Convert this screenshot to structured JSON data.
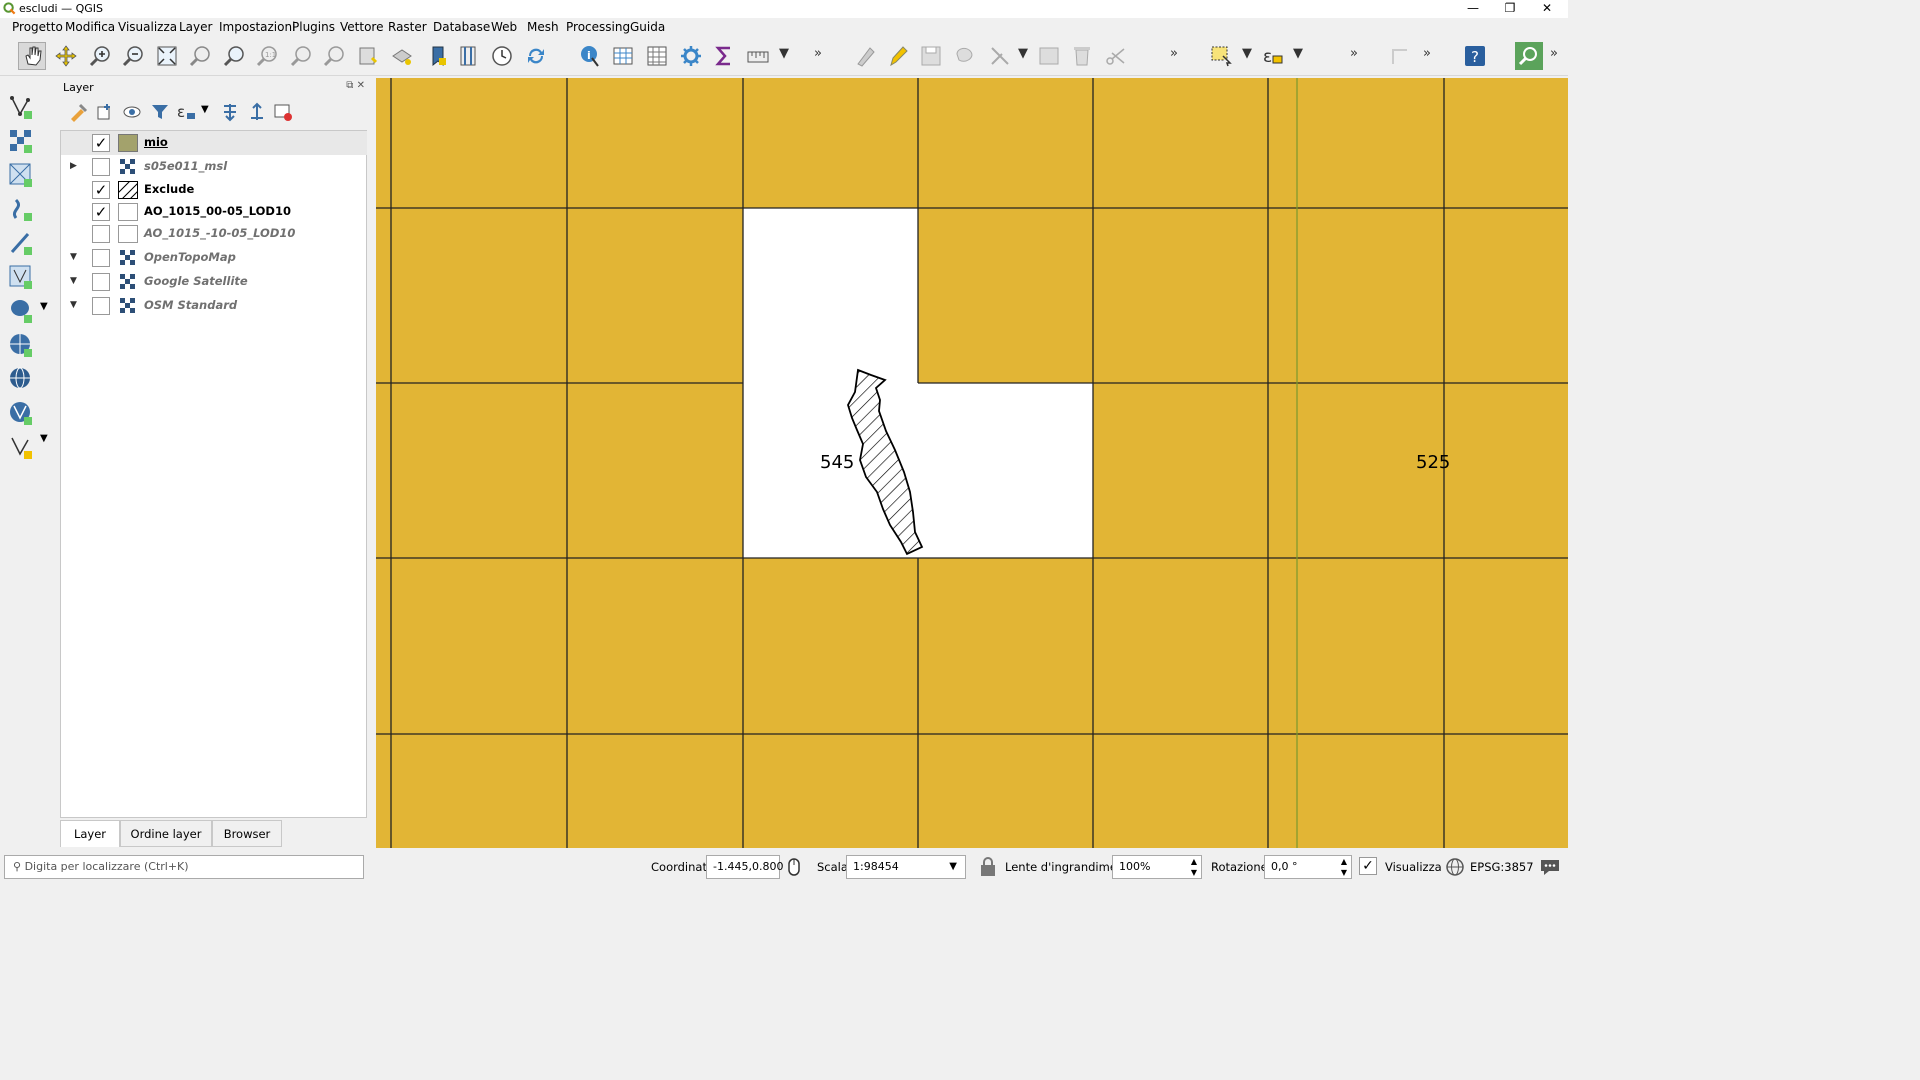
{
  "window": {
    "title": "escludi — QGIS",
    "controls": [
      "—",
      "❐",
      "✕"
    ]
  },
  "menubar": [
    "Progetto",
    "Modifica",
    "Visualizza",
    "Layer",
    "Impostazioni",
    "Plugins",
    "Vettore",
    "Raster",
    "Database",
    "Web",
    "Mesh",
    "Processing",
    "Guida"
  ],
  "toolbar": {
    "icons": [
      "pan-icon",
      "pan-to-selection-icon",
      "zoom-in-icon",
      "zoom-out-icon",
      "zoom-full-icon",
      "zoom-to-selection-icon",
      "zoom-to-layer-icon",
      "zoom-native-icon",
      "zoom-last-icon",
      "zoom-next-icon",
      "new-bookmark-icon",
      "show-bookmarks-icon",
      "new-map-view-icon",
      "new-3d-view-icon",
      "temporal-icon",
      "refresh-icon",
      "identify-icon",
      "attribute-table-icon",
      "field-calculator-icon",
      "processing-toolbox-icon",
      "statistics-icon",
      "measure-icon",
      "digitize-icon",
      "edit-pencil-icon",
      "save-edits-icon",
      "add-feature-icon",
      "vertex-tool-icon",
      "modify-attributes-icon",
      "delete-icon",
      "cut-icon",
      "select-icon",
      "select-expression-icon",
      "annotation-icon",
      "help-icon",
      "locator-icon"
    ],
    "more": "»"
  },
  "layers_panel": {
    "title": "Layer",
    "layers": [
      {
        "name": "mio",
        "checked": true,
        "expand": "",
        "style": "bu",
        "symbol": "fill-olive"
      },
      {
        "name": "s05e011_msl",
        "checked": false,
        "expand": "▶",
        "style": "i",
        "symbol": "raster"
      },
      {
        "name": "Exclude",
        "checked": true,
        "expand": "",
        "style": "b",
        "symbol": "hatch"
      },
      {
        "name": "AO_1015_00-05_LOD10",
        "checked": true,
        "expand": "",
        "style": "b",
        "symbol": "outline"
      },
      {
        "name": "AO_1015_-10-05_LOD10",
        "checked": false,
        "expand": "",
        "style": "i",
        "symbol": "outline"
      },
      {
        "name": "OpenTopoMap",
        "checked": false,
        "expand": "▼",
        "style": "i",
        "symbol": "raster"
      },
      {
        "name": "Google Satellite",
        "checked": false,
        "expand": "▼",
        "style": "i",
        "symbol": "raster"
      },
      {
        "name": "OSM Standard",
        "checked": false,
        "expand": "▼",
        "style": "i",
        "symbol": "raster"
      }
    ],
    "tabs": [
      "Layer",
      "Ordine layer",
      "Browser"
    ]
  },
  "map": {
    "fill_color": "#e2b535",
    "labels": [
      "545",
      "525"
    ]
  },
  "statusbar": {
    "search_placeholder": "Digita per localizzare (Ctrl+K)",
    "coord_label": "Coordinata",
    "coord_value": "-1.445,0.800",
    "scale_label": "Scala",
    "scale_value": "1:98454",
    "magnifier_label": "Lente d'ingrandimento",
    "magnifier_value": "100%",
    "rotation_label": "Rotazione",
    "rotation_value": "0,0 °",
    "render_label": "Visualizza",
    "crs": "EPSG:3857"
  }
}
